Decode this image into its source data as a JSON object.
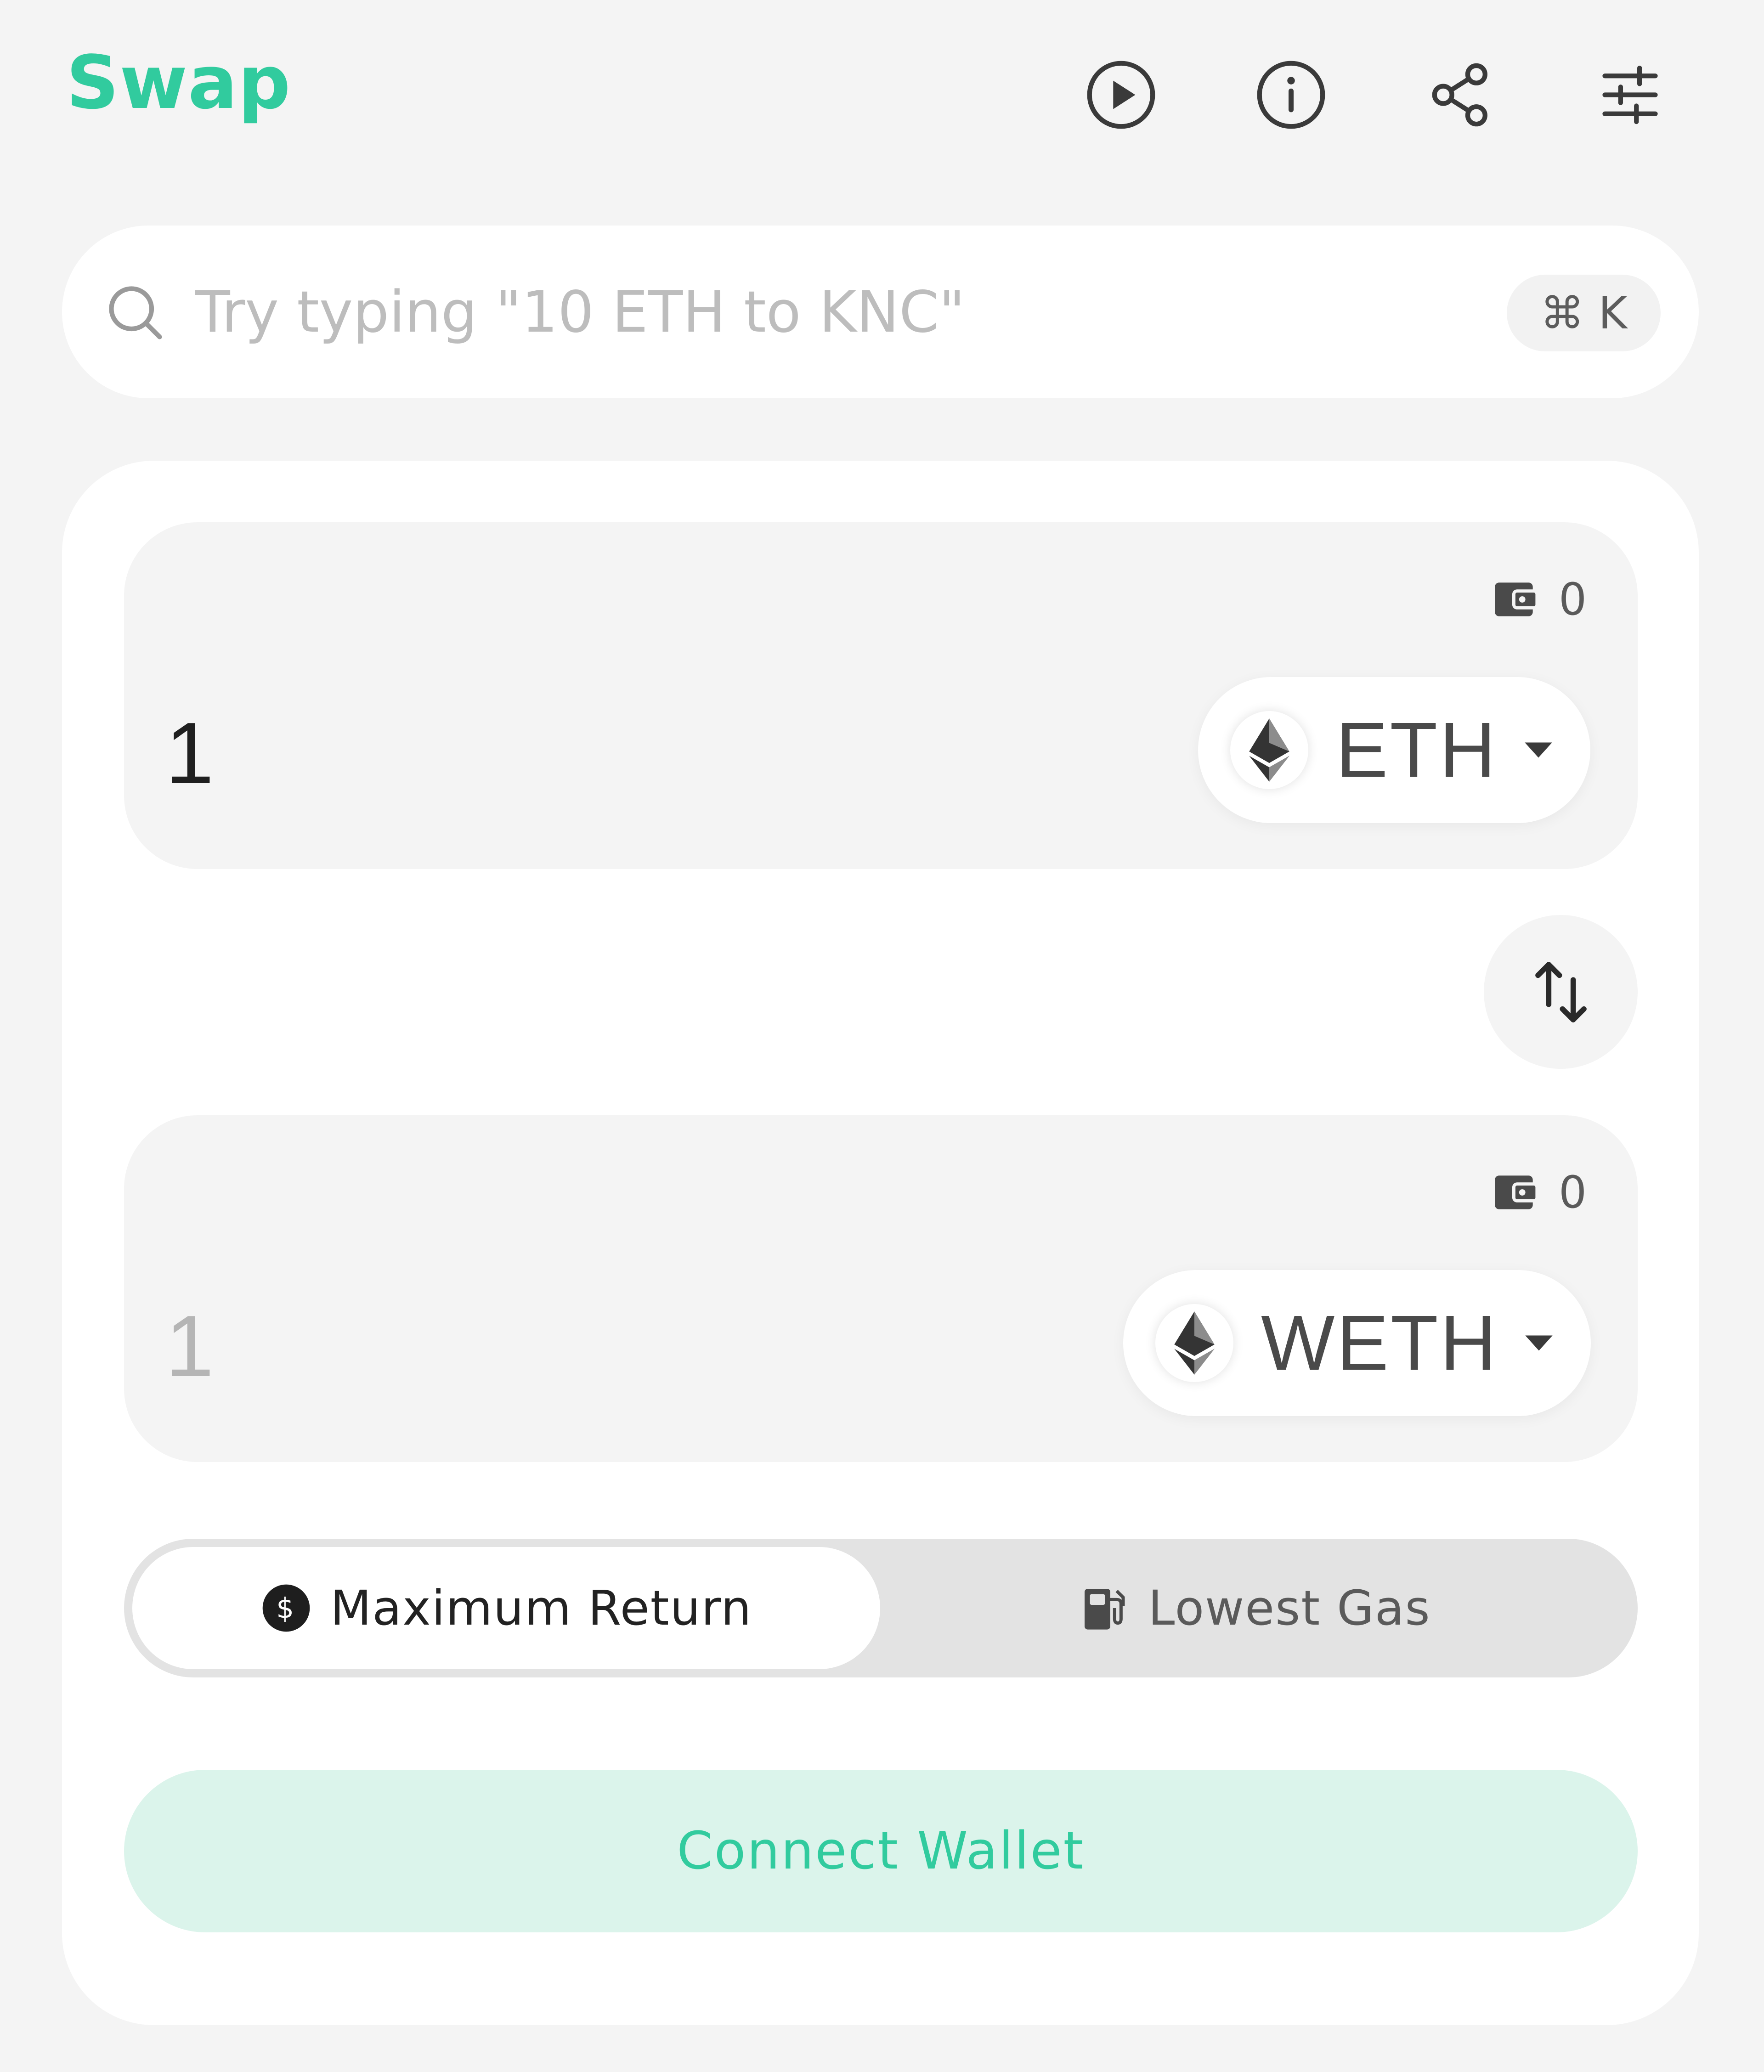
{
  "header": {
    "title": "Swap",
    "icons": [
      "play-tutorial-icon",
      "info-icon",
      "share-icon",
      "settings-sliders-icon"
    ]
  },
  "search": {
    "placeholder": "Try typing \"10 ETH to KNC\"",
    "shortcut": "⌘ K"
  },
  "from": {
    "balance": "0",
    "amount": "1",
    "token": "ETH"
  },
  "to": {
    "balance": "0",
    "amount": "1",
    "token": "WETH"
  },
  "route_options": [
    {
      "label": "Maximum Return",
      "icon": "dollar-circle-icon",
      "selected": true
    },
    {
      "label": "Lowest Gas",
      "icon": "gas-pump-icon",
      "selected": false
    }
  ],
  "connect_label": "Connect Wallet",
  "colors": {
    "accent": "#31cb9e",
    "accent_light": "#dbf4eb",
    "background": "#f4f4f4"
  }
}
